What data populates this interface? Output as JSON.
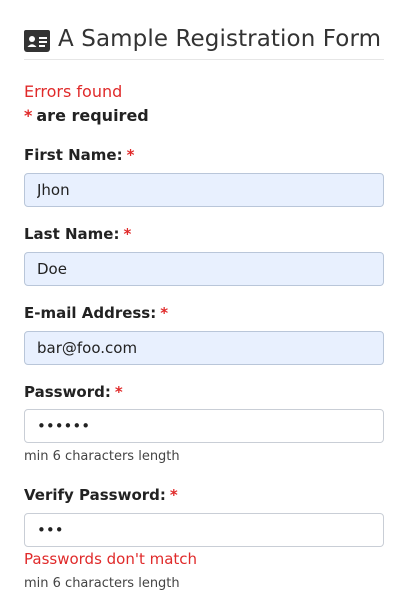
{
  "header": {
    "title": "A Sample Registration Form",
    "icon": "id-card-icon"
  },
  "status": {
    "errors_text": "Errors found",
    "required_marker": "*",
    "required_text": "are required"
  },
  "fields": {
    "first_name": {
      "label": "First Name:",
      "required_marker": "*",
      "value": "Jhon"
    },
    "last_name": {
      "label": "Last Name:",
      "required_marker": "*",
      "value": "Doe"
    },
    "email": {
      "label": "E-mail Address:",
      "required_marker": "*",
      "value": "bar@foo.com"
    },
    "password": {
      "label": "Password:",
      "required_marker": "*",
      "value": "••••••",
      "help": "min 6 characters length"
    },
    "verify_password": {
      "label": "Verify Password:",
      "required_marker": "*",
      "value": "•••",
      "error": "Passwords don't match",
      "help": "min 6 characters length"
    }
  },
  "colors": {
    "error": "#e02a2a",
    "autofill_bg": "#e8f0fe"
  }
}
